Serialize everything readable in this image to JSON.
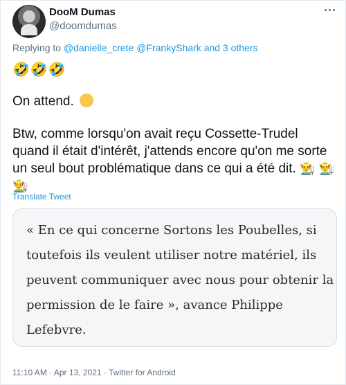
{
  "tweet": {
    "author_name": "DooM Dumas",
    "author_handle": "@doomdumas",
    "reply_prefix": "Replying to",
    "reply_user_1": "@danielle_crete",
    "reply_user_2": "@FrankyShark",
    "reply_others": "and 3 others",
    "emoji_line": "🤣🤣🤣",
    "paragraph_1": "On attend.",
    "paragraph_2": "Btw, comme lorsqu'on avait reçu Cossette-Trudel quand il était d'intérêt, j'attends encore qu'on me sorte un seul bout problématique dans ce qui a été dit.",
    "farmer_emoji": "👨‍🌾",
    "translate_label": "Translate Tweet",
    "quote": "« En ce qui concerne Sortons les Poubelles, si toutefois ils veulent utiliser notre matériel, ils peuvent communiquer avec nous pour obtenir la permission de le faire », avance Philippe Lefebvre.",
    "time": "11:10 AM",
    "date": "Apr 13, 2021",
    "source": "Twitter for Android",
    "separator": "·"
  },
  "icons": {
    "more": "more-horizontal-icon",
    "wink": "winking-face-icon",
    "farmer": "farmer-emoji-icon"
  },
  "colors": {
    "link": "#1b95e0",
    "secondary_text": "#5b7083",
    "quote_bg": "#f5f6f7"
  }
}
